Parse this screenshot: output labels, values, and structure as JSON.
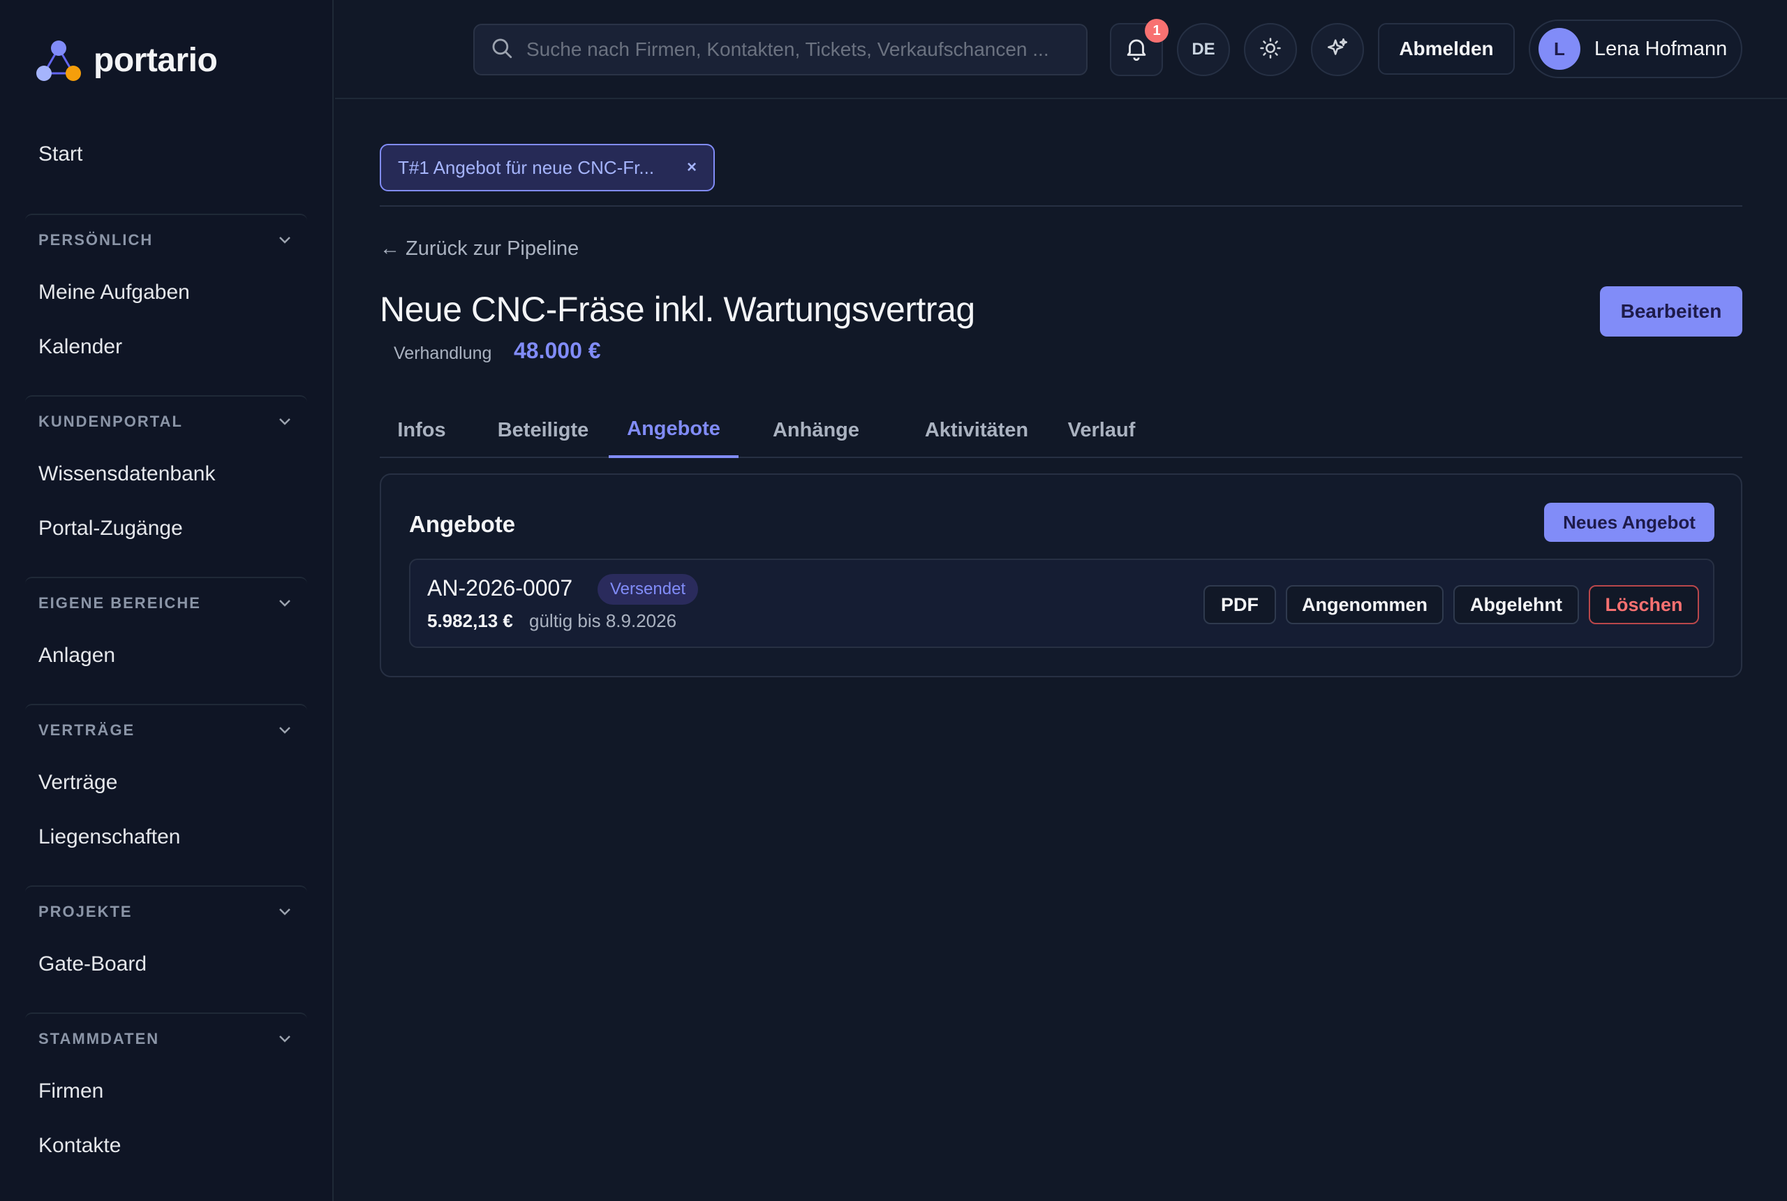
{
  "brand": {
    "name": "portario"
  },
  "sidebar": {
    "start": "Start",
    "groups": [
      {
        "title": "PERSÖNLICH",
        "items": [
          "Meine Aufgaben",
          "Kalender"
        ]
      },
      {
        "title": "KUNDENPORTAL",
        "items": [
          "Wissensdatenbank",
          "Portal-Zugänge"
        ]
      },
      {
        "title": "EIGENE BEREICHE",
        "items": [
          "Anlagen"
        ]
      },
      {
        "title": "VERTRÄGE",
        "items": [
          "Verträge",
          "Liegenschaften"
        ]
      },
      {
        "title": "PROJEKTE",
        "items": [
          "Gate-Board"
        ]
      },
      {
        "title": "STAMMDATEN",
        "items": [
          "Firmen",
          "Kontakte"
        ]
      }
    ]
  },
  "topbar": {
    "search_placeholder": "Suche nach Firmen, Kontakten, Tickets, Verkaufschancen ...",
    "notification_count": "1",
    "language": "DE",
    "logout_label": "Abmelden",
    "user": {
      "initial": "L",
      "name": "Lena Hofmann"
    }
  },
  "ticket_tab": {
    "label": "T#1 Angebot für neue CNC-Fr...",
    "close": "×"
  },
  "page": {
    "back_link": "← Zurück zur Pipeline",
    "title": "Neue CNC-Fräse inkl. Wartungsvertrag",
    "stage": "Verhandlung",
    "amount": "48.000 €",
    "edit_label": "Bearbeiten"
  },
  "tabs": [
    {
      "label": "Infos",
      "active": false
    },
    {
      "label": "Beteiligte",
      "active": false
    },
    {
      "label": "Angebote",
      "active": true
    },
    {
      "label": "Anhänge",
      "active": false
    },
    {
      "label": "Aktivitäten",
      "active": false
    },
    {
      "label": "Verlauf",
      "active": false
    }
  ],
  "offers_panel": {
    "title": "Angebote",
    "new_label": "Neues Angebot",
    "offers": [
      {
        "number": "AN-2026-0007",
        "status": "Versendet",
        "sum": "5.982,13 €",
        "valid": "gültig bis 8.9.2026",
        "actions": {
          "pdf": "PDF",
          "accepted": "Angenommen",
          "rejected": "Abgelehnt",
          "delete": "Löschen"
        }
      }
    ]
  },
  "colors": {
    "accent": "#818cf8",
    "danger": "#f87171",
    "background": "#111827",
    "sidebar": "#0f1525"
  }
}
